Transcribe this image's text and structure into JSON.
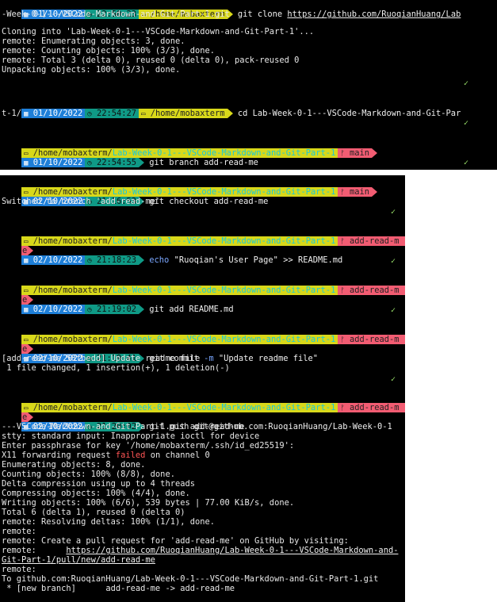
{
  "term1": {
    "prompt1": {
      "date": "01/10/2022",
      "time": "22:50:23",
      "path": "/home/mobaxterm",
      "cmd": "git clone ",
      "url": "https://github.com/RuoqianHuang/Lab"
    },
    "wrap1": "-Week-0-1---VSCode-Markdown-and-Git-Part-1.git",
    "out": [
      "Cloning into 'Lab-Week-0-1---VSCode-Markdown-and-Git-Part-1'...",
      "remote: Enumerating objects: 3, done.",
      "remote: Counting objects: 100% (3/3), done.",
      "remote: Total 3 (delta 0), reused 0 (delta 0), pack-reused 0",
      "Unpacking objects: 100% (3/3), done."
    ],
    "prompt2": {
      "date": "01/10/2022",
      "time": "22:54:27",
      "path": "/home/mobaxterm",
      "cmd": "cd Lab-Week-0-1---VSCode-Markdown-and-Git-Par"
    },
    "wrap2": "t-1/",
    "prompt3": {
      "path": "/home/mobaxterm/",
      "dir": "Lab-Week-0-1---VSCode-Markdown-and-Git-Part-1",
      "branch": "main",
      "date": "01/10/2022",
      "time": "22:54:55",
      "cmd": "git branch add-read-me"
    }
  },
  "term2": {
    "p1": {
      "path": "/home/mobaxterm/",
      "dir": "Lab-Week-0-1---VSCode-Markdown-and-Git-Part-1",
      "branch": "main",
      "date": "02/10/2022",
      "time": "21:16:53",
      "cmd": "git checkout add-read-me"
    },
    "p1_out": "Switched to branch 'add-read-me'",
    "p2": {
      "path": "/home/mobaxterm/",
      "dir": "Lab-Week-0-1---VSCode-Markdown-and-Git-Part-1",
      "branch": "add-read-m",
      "branch_wrap": "e",
      "date": "02/10/2022",
      "time": "21:18:23",
      "cmd_a": "echo",
      "cmd_b": " \"Ruoqian's User Page\" >> README.md"
    },
    "p3": {
      "path": "/home/mobaxterm/",
      "dir": "Lab-Week-0-1---VSCode-Markdown-and-Git-Part-1",
      "branch": "add-read-m",
      "branch_wrap": "e",
      "date": "02/10/2022",
      "time": "21:19:02",
      "cmd": "git add README.md"
    },
    "p4": {
      "path": "/home/mobaxterm/",
      "dir": "Lab-Week-0-1---VSCode-Markdown-and-Git-Part-1",
      "branch": "add-read-m",
      "branch_wrap": "e",
      "date": "02/10/2022",
      "time": "21:19:41",
      "cmd_a": "git commit ",
      "cmd_flag": "-m",
      "cmd_b": " \"Update readme file\""
    },
    "p4_out": [
      "[add-read-me 58fbedd] Update readme file",
      " 1 file changed, 1 insertion(+), 1 deletion(-)"
    ],
    "p5": {
      "path": "/home/mobaxterm/",
      "dir": "Lab-Week-0-1---VSCode-Markdown-and-Git-Part-1",
      "branch": "add-read-m",
      "branch_wrap": "e",
      "date": "02/10/2022",
      "time": "21:20:02",
      "cmd": "git push git@github.com:RuoqianHuang/Lab-Week-0-1"
    },
    "p5_wrap": "---VSCode-Markdown-and-Git-Part-1.git add-read-me",
    "out_a": [
      "stty: standard input: Inappropriate ioctl for device",
      "Enter passphrase for key '/home/mobaxterm/.ssh/id_ed25519':"
    ],
    "x11_a": "X11 forwarding request ",
    "x11_failed": "failed",
    "x11_b": " on channel 0",
    "out_b": [
      "Enumerating objects: 8, done.",
      "Counting objects: 100% (8/8), done.",
      "Delta compression using up to 4 threads",
      "Compressing objects: 100% (4/4), done.",
      "Writing objects: 100% (6/6), 539 bytes | 77.00 KiB/s, done.",
      "Total 6 (delta 1), reused 0 (delta 0)",
      "remote: Resolving deltas: 100% (1/1), done.",
      "remote:",
      "remote: Create a pull request for 'add-read-me' on GitHub by visiting:"
    ],
    "remote_prefix": "remote:      ",
    "pr_url": "https://github.com/RuoqianHuang/Lab-Week-0-1---VSCode-Markdown-and-",
    "pr_url_wrap": "Git-Part-1/pull/new/add-read-me",
    "out_c": [
      "remote:",
      "To github.com:RuoqianHuang/Lab-Week-0-1---VSCode-Markdown-and-Git-Part-1.git",
      " * [new branch]      add-read-me -> add-read-me"
    ]
  },
  "checkmark": "✓",
  "icons": {
    "calendar": "calendar-icon",
    "clock": "clock-icon",
    "folder": "folder-icon",
    "branch": "git-branch-icon"
  },
  "colors": {
    "date": "#1e7fd8",
    "time": "#0f9a86",
    "path": "#d8d81a",
    "git": "#f25c72",
    "dir": "#1ac8d8",
    "check": "#9be36a",
    "failed": "#ff5555"
  }
}
